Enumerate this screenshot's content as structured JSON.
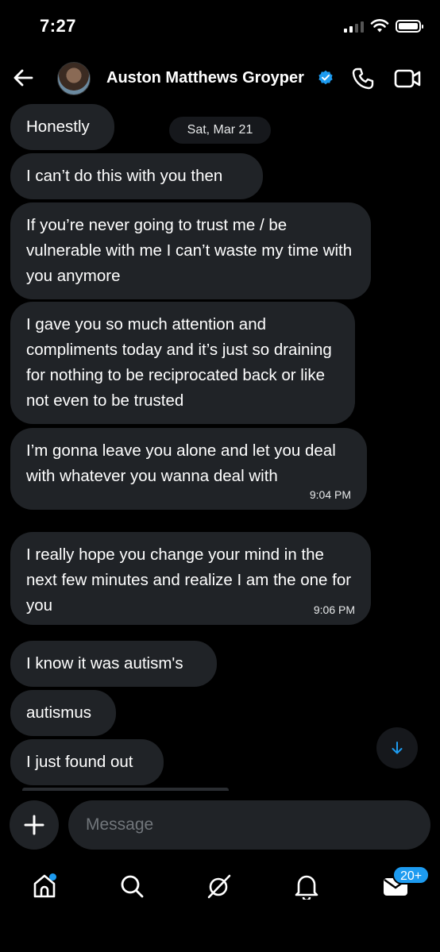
{
  "status_bar": {
    "time": "7:27"
  },
  "header": {
    "contact_name": "Auston Matthews Groyper"
  },
  "conversation": {
    "date_separator": "Sat, Mar 21",
    "messages": [
      {
        "text": "Honestly"
      },
      {
        "text": "I can’t do this with you then"
      },
      {
        "text": "If you’re never going to trust me / be vulnerable with me I can’t waste my time with you anymore"
      },
      {
        "text": "I gave you so much attention and compliments today and it’s just so draining for nothing to be reciprocated back or like not even to be trusted"
      },
      {
        "text": "I’m gonna leave you alone and let you deal with whatever  you wanna deal with",
        "time": "9:04 PM"
      },
      {
        "text": "I really hope you change your mind in the next few minutes and realize I am the one for you",
        "time": "9:06 PM"
      },
      {
        "text": "I know it was autism's"
      },
      {
        "text": "autismus"
      },
      {
        "text": "I just found out"
      }
    ]
  },
  "composer": {
    "placeholder": "Message"
  },
  "bottom_nav": {
    "messages_badge": "20+"
  },
  "colors": {
    "accent": "#1d9bf0",
    "bubble": "#202327",
    "background": "#000000"
  }
}
